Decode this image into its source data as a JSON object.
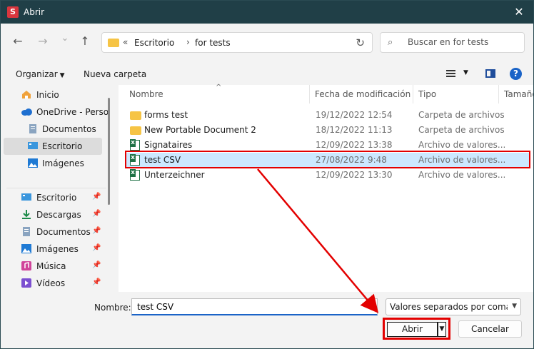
{
  "window": {
    "title": "Abrir",
    "app_icon_letter": "S",
    "close_glyph": "✕"
  },
  "nav": {
    "back_glyph": "←",
    "forward_glyph": "→",
    "recent_glyph": "⌄",
    "up_glyph": "↑",
    "breadcrumb_chevron": "«",
    "breadcrumbs": [
      "Escritorio",
      "for tests"
    ],
    "breadcrumb_sep": "›",
    "refresh_glyph": "↻",
    "search_placeholder": "Buscar en for tests"
  },
  "toolbar": {
    "organize_label": "Organizar",
    "new_folder_label": "Nueva carpeta"
  },
  "sidebar": {
    "items": [
      {
        "label": "Inicio",
        "icon": "home-icon"
      },
      {
        "label": "OneDrive - Perso",
        "icon": "cloud-icon"
      },
      {
        "label": "Documentos",
        "icon": "document-icon"
      },
      {
        "label": "Escritorio",
        "icon": "desktop-icon",
        "selected": true
      },
      {
        "label": "Imágenes",
        "icon": "image-icon"
      }
    ],
    "pinned": [
      {
        "label": "Escritorio",
        "icon": "desktop-icon"
      },
      {
        "label": "Descargas",
        "icon": "download-icon"
      },
      {
        "label": "Documentos",
        "icon": "document-icon"
      },
      {
        "label": "Imágenes",
        "icon": "image-icon"
      },
      {
        "label": "Música",
        "icon": "music-icon"
      },
      {
        "label": "Vídeos",
        "icon": "video-icon"
      }
    ],
    "pin_glyph": "📌"
  },
  "files": {
    "columns": [
      "Nombre",
      "Fecha de modificación",
      "Tipo",
      "Tamaño"
    ],
    "sort_glyph": "^",
    "rows": [
      {
        "name": "forms test",
        "date": "19/12/2022 12:54",
        "type": "Carpeta de archivos",
        "kind": "folder"
      },
      {
        "name": "New Portable Document 2",
        "date": "18/12/2022 11:13",
        "type": "Carpeta de archivos",
        "kind": "folder"
      },
      {
        "name": "Signataires",
        "date": "12/09/2022 13:38",
        "type": "Archivo de valores...",
        "kind": "csv"
      },
      {
        "name": "test CSV",
        "date": "27/08/2022 9:48",
        "type": "Archivo de valores...",
        "kind": "csv",
        "selected": true
      },
      {
        "name": "Unterzeichner",
        "date": "12/09/2022 13:30",
        "type": "Archivo de valores...",
        "kind": "csv"
      }
    ]
  },
  "bottom": {
    "name_label": "Nombre:",
    "name_value": "test CSV",
    "file_type": "Valores separados por comas (*",
    "open_label": "Abrir",
    "cancel_label": "Cancelar"
  },
  "colors": {
    "titlebar": "#203f47",
    "highlight": "#e30000",
    "selection": "#cce8ff"
  }
}
